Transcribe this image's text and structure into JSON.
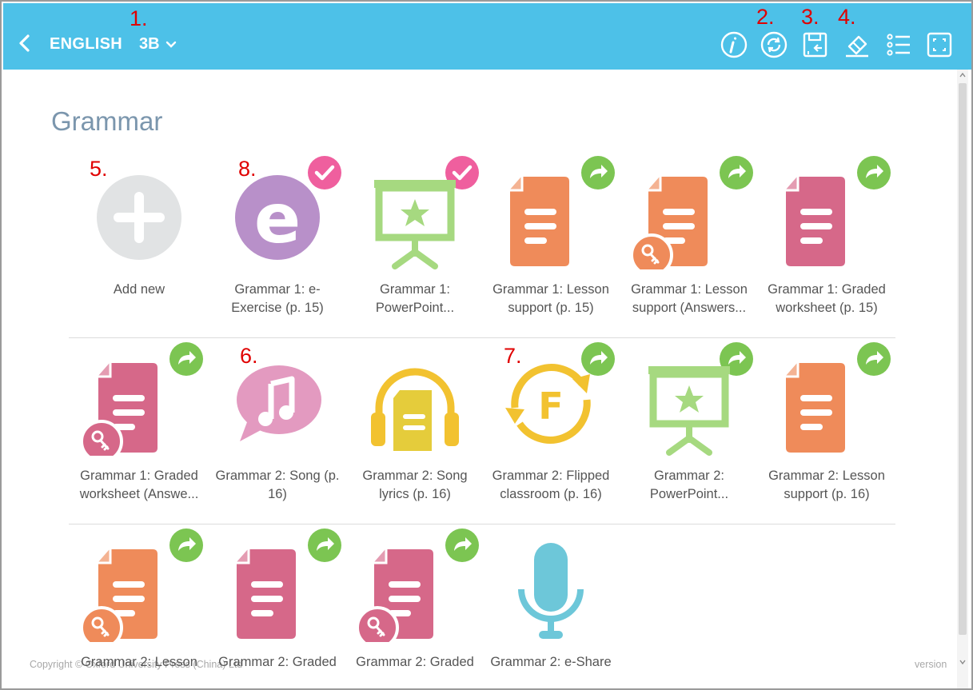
{
  "header": {
    "subject": "ENGLISH",
    "level": "3B",
    "tools": [
      "info-icon",
      "sync-icon",
      "save-icon",
      "eraser-icon",
      "list-icon",
      "fullscreen-icon"
    ]
  },
  "annotations": {
    "n1": "1.",
    "n2": "2.",
    "n3": "3.",
    "n4": "4.",
    "n5": "5.",
    "n6": "6.",
    "n7": "7.",
    "n8": "8."
  },
  "section": {
    "title": "Grammar"
  },
  "tiles": [
    {
      "label": "Add new",
      "icon": "add-icon"
    },
    {
      "label": "Grammar 1: e-Exercise (p. 15)",
      "icon": "e-exercise-icon",
      "badge": "check"
    },
    {
      "label": "Grammar 1: PowerPoint...",
      "icon": "presentation-icon",
      "badge": "check"
    },
    {
      "label": "Grammar 1: Lesson support (p. 15)",
      "icon": "document-icon",
      "badge": "share"
    },
    {
      "label": "Grammar 1: Lesson support (Answers...",
      "icon": "document-key-icon",
      "badge": "share"
    },
    {
      "label": "Grammar 1: Graded worksheet (p. 15)",
      "icon": "document-icon",
      "badge": "share"
    },
    {
      "label": "Grammar 1: Graded worksheet (Answe...",
      "icon": "document-key-icon",
      "badge": "share"
    },
    {
      "label": "Grammar 2: Song (p. 16)",
      "icon": "music-icon"
    },
    {
      "label": "Grammar 2: Song lyrics (p. 16)",
      "icon": "audio-document-icon"
    },
    {
      "label": "Grammar 2: Flipped classroom (p. 16)",
      "icon": "flipped-classroom-icon",
      "badge": "share"
    },
    {
      "label": "Grammar 2: PowerPoint...",
      "icon": "presentation-icon",
      "badge": "share"
    },
    {
      "label": "Grammar 2: Lesson support (p. 16)",
      "icon": "document-icon",
      "badge": "share"
    },
    {
      "label": "Grammar 2: Lesson",
      "icon": "document-key-icon",
      "badge": "share"
    },
    {
      "label": "Grammar 2: Graded",
      "icon": "document-icon",
      "badge": "share"
    },
    {
      "label": "Grammar 2: Graded",
      "icon": "document-key-icon",
      "badge": "share"
    },
    {
      "label": "Grammar 2: e-Share",
      "icon": "microphone-icon"
    }
  ],
  "footer": {
    "copyright": "Copyright © Oxford University Press (China) Ltd",
    "version": "version"
  },
  "colors": {
    "header": "#4dc1e8",
    "orange": "#ef8b5a",
    "pink": "#d66889",
    "green_badge": "#7cc552",
    "check_badge": "#ef5f9e",
    "purple": "#b890c9",
    "yellow": "#f2c230",
    "presentation_green": "#a6d980",
    "mic_blue": "#6dc7d9",
    "annotation_red": "#e00000"
  }
}
